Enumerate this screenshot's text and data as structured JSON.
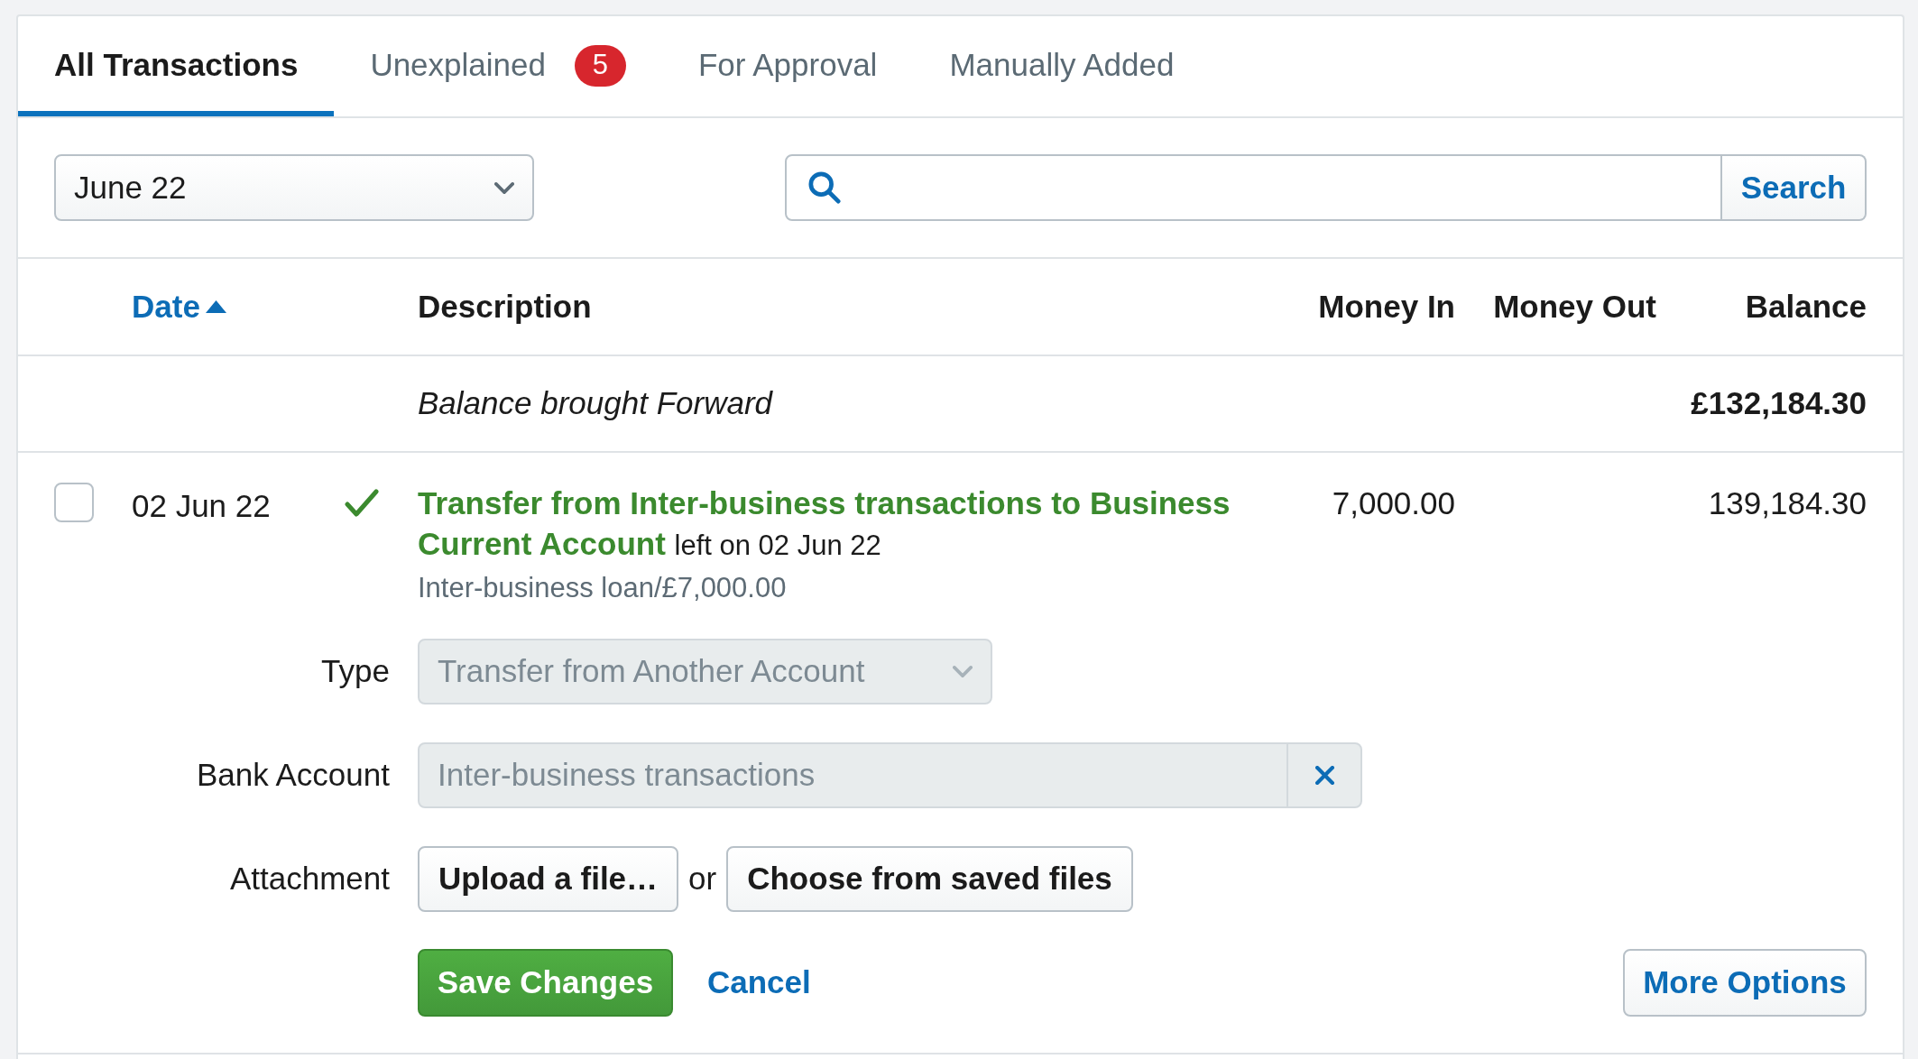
{
  "tabs": [
    {
      "label": "All Transactions",
      "selected": true
    },
    {
      "label": "Unexplained",
      "selected": false,
      "badge": "5"
    },
    {
      "label": "For Approval",
      "selected": false
    },
    {
      "label": "Manually Added",
      "selected": false
    }
  ],
  "filters": {
    "period": {
      "value": "June 22"
    },
    "search": {
      "button": "Search"
    }
  },
  "table": {
    "columns": [
      {
        "label": "Date",
        "sorted": true
      },
      {
        "label": "Description",
        "sorted": false
      },
      {
        "label": "Money In",
        "sorted": false
      },
      {
        "label": "Money Out",
        "sorted": false
      },
      {
        "label": "Balance",
        "sorted": false
      }
    ],
    "opening_row": {
      "description": "Balance brought Forward",
      "balance": "£132,184.30"
    },
    "rows": [
      {
        "checked": false,
        "date": "02 Jun 22",
        "explained": true,
        "title": "Transfer from Inter-business transactions to Business Current Account",
        "note": "left on 02 Jun 22",
        "reference": "Inter-business loan/£7,000.00",
        "money_in": "7,000.00",
        "balance": "139,184.30"
      }
    ]
  },
  "editor": {
    "fields": [
      {
        "kind": "select",
        "label": "Type",
        "value": "Transfer from Another Account",
        "disabled": true
      },
      {
        "kind": "lookup",
        "label": "Bank Account",
        "value": "Inter-business transactions",
        "disabled": true
      },
      {
        "kind": "attachment",
        "label": "Attachment",
        "buttons": [
          "Upload a file…",
          "Choose from saved files"
        ],
        "separator": "or"
      }
    ],
    "save": "Save Changes",
    "cancel": "Cancel",
    "more": "More Options"
  }
}
